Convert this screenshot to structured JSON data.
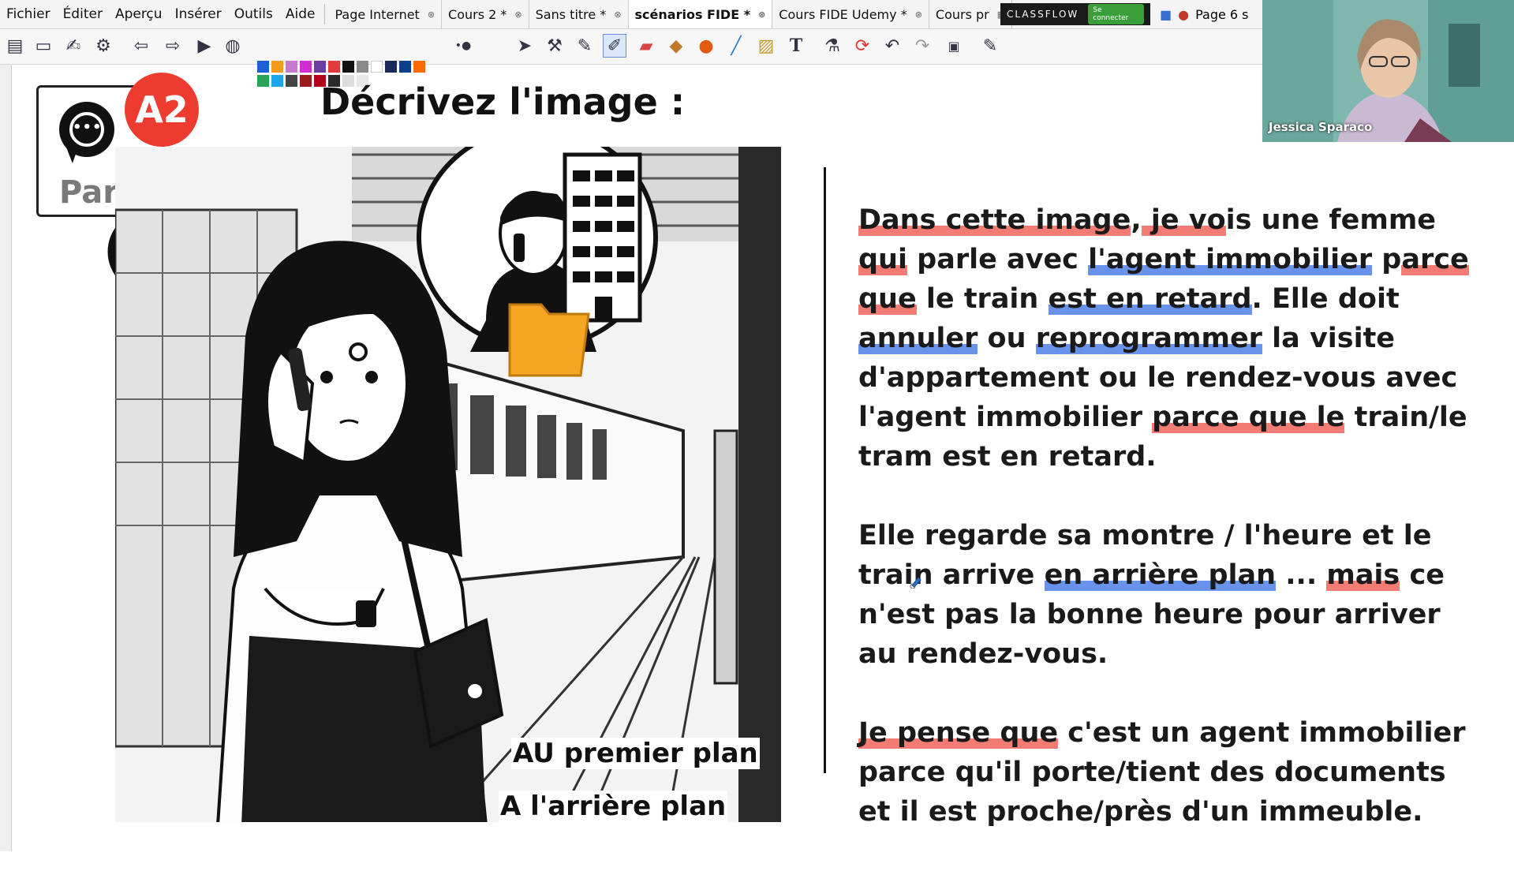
{
  "menubar": {
    "menus": [
      "Fichier",
      "Éditer",
      "Aperçu",
      "Insérer",
      "Outils",
      "Aide"
    ],
    "tabs": [
      {
        "label": "Page Internet",
        "active": false
      },
      {
        "label": "Cours 2 *",
        "active": false
      },
      {
        "label": "Sans titre *",
        "active": false
      },
      {
        "label": "scénarios FIDE  *",
        "active": true
      },
      {
        "label": "Cours FIDE Udemy *",
        "active": false
      },
      {
        "label": "Cours pr",
        "active": false
      }
    ],
    "classflow_label": "CLASSFLOW",
    "classflow_button": "Se connecter",
    "page_tab": "Page 6 s"
  },
  "toolbar": {
    "icons": [
      "flipchart-icon",
      "id-card-icon",
      "signature-icon",
      "settings-icon",
      "back-icon",
      "forward-icon",
      "play-icon",
      "globe-icon",
      "pointer-icon",
      "tools-icon",
      "pen-icon",
      "highlighter-icon",
      "eraser-icon",
      "fill-icon",
      "shape-icon",
      "connector-icon",
      "clapper-icon",
      "text-icon",
      "clear-icon",
      "reset-icon",
      "undo-icon",
      "redo-icon",
      "page-icon",
      "edit-icon"
    ],
    "palette": [
      "#1e5fd6",
      "#f39b1d",
      "#c77ac9",
      "#cf2fd0",
      "#e33a3a",
      "#111111",
      "#8a8a8a",
      "#ffffff",
      "#1b2a5c",
      "#0b3f8a",
      "#ff6a00",
      "#27a552",
      "#1aa6e8",
      "#6b3fa0",
      "#444444",
      "#9a1b1b",
      "#b3001b",
      "#2a2a2a",
      "#dddddd",
      "#e8e8e8"
    ],
    "selected_tool": "highlighter-icon"
  },
  "slide": {
    "speak_label": "Parler",
    "level": "A2",
    "title": "Décrivez l'image :",
    "caption_foreground": "AU premier plan",
    "caption_background": "A l'arrière plan",
    "paragraphs": [
      [
        {
          "t": "Dans cette image",
          "hl": "r"
        },
        {
          "t": ",",
          "hl": ""
        },
        {
          "t": " je vo",
          "hl": "r"
        },
        {
          "t": "is une femme ",
          "hl": ""
        },
        {
          "t": "qui",
          "hl": "r"
        },
        {
          "t": " parle avec ",
          "hl": ""
        },
        {
          "t": "l'agent immobilier",
          "hl": "b"
        },
        {
          "t": " p",
          "hl": ""
        },
        {
          "t": "arce que",
          "hl": "r"
        },
        {
          "t": " le train ",
          "hl": ""
        },
        {
          "t": "est en retard",
          "hl": "b"
        },
        {
          "t": ". Elle doit ",
          "hl": ""
        },
        {
          "t": "annuler",
          "hl": "b"
        },
        {
          "t": " ou ",
          "hl": ""
        },
        {
          "t": "reprogrammer",
          "hl": "b"
        },
        {
          "t": " la visite d'appartement ou le rendez-vous avec l'agent immobilier ",
          "hl": ""
        },
        {
          "t": "parce que le",
          "hl": "r"
        },
        {
          "t": " train/le tram est en retard.",
          "hl": ""
        }
      ],
      [
        {
          "t": "Elle regarde sa montre / l'heure et le train arrive ",
          "hl": ""
        },
        {
          "t": "en arrière plan",
          "hl": "b"
        },
        {
          "t": " ... ",
          "hl": ""
        },
        {
          "t": "mais",
          "hl": "r"
        },
        {
          "t": " ce n'est pas la bonne heure pour arriver au rendez-vous.",
          "hl": ""
        }
      ],
      [
        {
          "t": "Je pense que",
          "hl": "r"
        },
        {
          "t": " c'est un agent immobilier parce qu'il porte/tient des documents et il est proche/près d'un immeuble.",
          "hl": ""
        }
      ]
    ]
  },
  "webcam": {
    "name": "Jessica Sparaco"
  }
}
